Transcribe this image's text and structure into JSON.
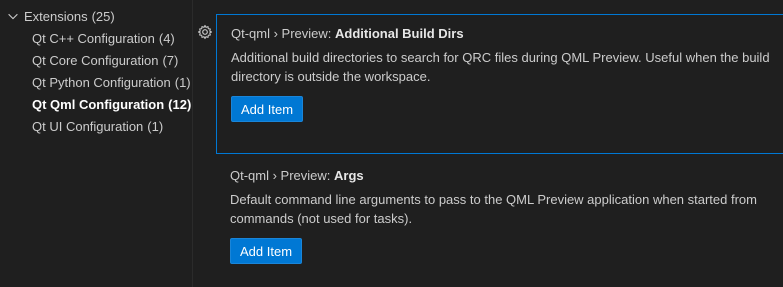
{
  "toc": {
    "group": {
      "label": "Extensions",
      "count": "(25)"
    },
    "items": [
      {
        "label": "Qt C++ Configuration",
        "count": "(4)"
      },
      {
        "label": "Qt Core Configuration",
        "count": "(7)"
      },
      {
        "label": "Qt Python Configuration",
        "count": "(1)"
      },
      {
        "label": "Qt Qml Configuration",
        "count": "(12)"
      },
      {
        "label": "Qt UI Configuration",
        "count": "(1)"
      }
    ],
    "active_index": 3
  },
  "settings": [
    {
      "category": "Qt-qml › Preview: ",
      "key": "Additional Build Dirs",
      "description": "Additional build directories to search for QRC files during QML Preview. Useful when the build directory is outside the workspace.",
      "button_label": "Add Item"
    },
    {
      "category": "Qt-qml › Preview: ",
      "key": "Args",
      "description": "Default command line arguments to pass to the QML Preview application when started from commands (not used for tasks).",
      "button_label": "Add Item"
    }
  ],
  "icons": {
    "group_toggle": "chevron-down-icon",
    "setting_menu": "gear-icon"
  },
  "colors": {
    "background": "#1f1f1f",
    "accent": "#0078d4",
    "text": "#cccccc"
  }
}
